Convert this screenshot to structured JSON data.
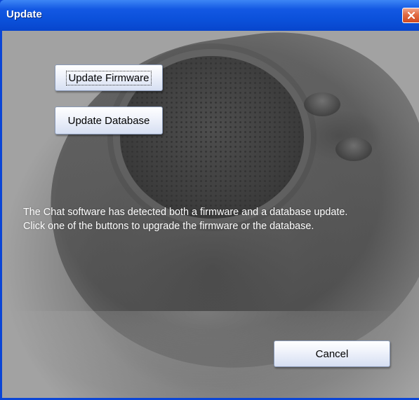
{
  "window": {
    "title": "Update"
  },
  "buttons": {
    "update_firmware": "Update Firmware",
    "update_database": "Update Database",
    "cancel": "Cancel"
  },
  "message": {
    "line1": "The Chat software has detected both a firmware and a database update.",
    "line2": "Click one of the buttons to upgrade the firmware or the database."
  },
  "icons": {
    "close": "close-icon"
  },
  "colors": {
    "titlebar": "#0a4fd8",
    "close_button": "#e16a42",
    "message_text": "#ffffff"
  }
}
